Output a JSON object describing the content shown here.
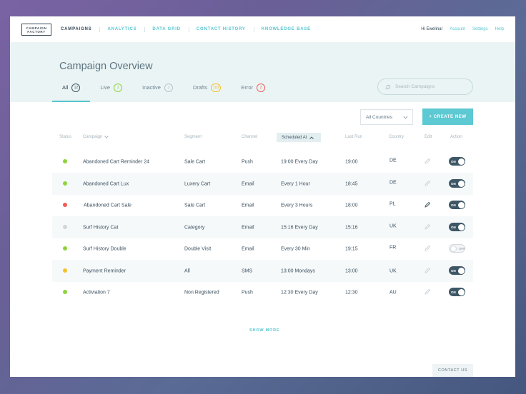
{
  "logo": {
    "line1": "CAMPAIGN",
    "line2": "FACTORY"
  },
  "nav": {
    "links": [
      "CAMPAIGNS",
      "ANALYTICS",
      "DATA GRID",
      "CONTACT HISTORY",
      "KNOWLEDGE BASE"
    ],
    "greeting": "Hi Ewelina!",
    "account": "Account",
    "settings": "Settings",
    "help": "Help"
  },
  "page": {
    "title": "Campaign Overview"
  },
  "tabs": [
    {
      "label": "All",
      "count": "12",
      "color": "#3e5766"
    },
    {
      "label": "Live",
      "count": "2",
      "color": "#8fd33c"
    },
    {
      "label": "Inactive",
      "count": "3",
      "color": "#b9c4c9"
    },
    {
      "label": "Drafts",
      "count": "103",
      "color": "#f2c12e"
    },
    {
      "label": "Error",
      "count": "2",
      "color": "#ef5e57"
    }
  ],
  "search": {
    "placeholder": "Search Campaigns"
  },
  "filters": {
    "country": "All Countries"
  },
  "actions": {
    "create": "+ CREATE NEW",
    "show_more": "SHOW MORE",
    "contact": "CONTACT US"
  },
  "table": {
    "headers": {
      "status": "Status",
      "campaign": "Campaign",
      "segment": "Segment",
      "channel": "Channel",
      "scheduled": "Scheduled At",
      "last_run": "Last Run",
      "country": "Country",
      "edit": "Edit",
      "action": "Action"
    },
    "rows": [
      {
        "status": "#8fd33c",
        "campaign": "Abandoned Cart Reminder 24",
        "segment": "Sale Cart",
        "channel": "Push",
        "scheduled": "19:00 Every Day",
        "last_run": "19:00",
        "country": "DE",
        "toggle": "ON"
      },
      {
        "status": "#8fd33c",
        "campaign": "Abandoned Cart Lux",
        "segment": "Luxery Cart",
        "channel": "Email",
        "scheduled": "Every 1 Hour",
        "last_run": "18:45",
        "country": "DE",
        "toggle": "ON"
      },
      {
        "status": "#ef5e57",
        "campaign": "Abandoned Cart Sale",
        "segment": "Sale Cart",
        "channel": "Email",
        "scheduled": "Every 3 Hours",
        "last_run": "18:00",
        "country": "PL",
        "toggle": "ON"
      },
      {
        "status": "#cfd6d9",
        "campaign": "Surf History Cat",
        "segment": "Category",
        "channel": "Email",
        "scheduled": "15:16 Every Day",
        "last_run": "15:16",
        "country": "UK",
        "toggle": "ON"
      },
      {
        "status": "#8fd33c",
        "campaign": "Surf History Double",
        "segment": "Double Visit",
        "channel": "Email",
        "scheduled": "Every 30 Min",
        "last_run": "19:15",
        "country": "FR",
        "toggle": "OFF"
      },
      {
        "status": "#f2c12e",
        "campaign": "Payment Reminder",
        "segment": "All",
        "channel": "SMS",
        "scheduled": "13:00 Mondays",
        "last_run": "13:00",
        "country": "UK",
        "toggle": "ON"
      },
      {
        "status": "#8fd33c",
        "campaign": "Activiation 7",
        "segment": "Non Registered",
        "channel": "Push",
        "scheduled": "12:30 Every Day",
        "last_run": "12:30",
        "country": "AU",
        "toggle": "ON"
      }
    ]
  }
}
